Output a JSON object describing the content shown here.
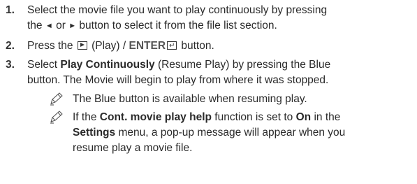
{
  "steps": [
    {
      "number": "1.",
      "line1": "Select the movie file you want to play continuously by pressing",
      "line2_a": "the",
      "left_arrow": "◄",
      "line2_b": "or",
      "right_arrow": "►",
      "line2_c": "button to select it from the file list section."
    },
    {
      "number": "2.",
      "text_a": "Press the",
      "play_label": "(Play) /",
      "enter_label": "ENTER",
      "text_b": "button."
    },
    {
      "number": "3.",
      "line1_a": "Select",
      "line1_bold": "Play Continuously",
      "line1_b": "(Resume Play) by pressing the Blue",
      "line2": "button. The Movie will begin to play from where it was stopped."
    }
  ],
  "notes": [
    {
      "line1": "The Blue button is available when resuming play."
    },
    {
      "line1_a": "If the",
      "line1_bold1": "Cont. movie play help",
      "line1_b": "function is set to",
      "line1_bold2": "On",
      "line1_c": "in the",
      "line2_bold": "Settings",
      "line2_a": "menu, a pop-up message will appear when you",
      "line3": "resume play a movie file."
    }
  ]
}
